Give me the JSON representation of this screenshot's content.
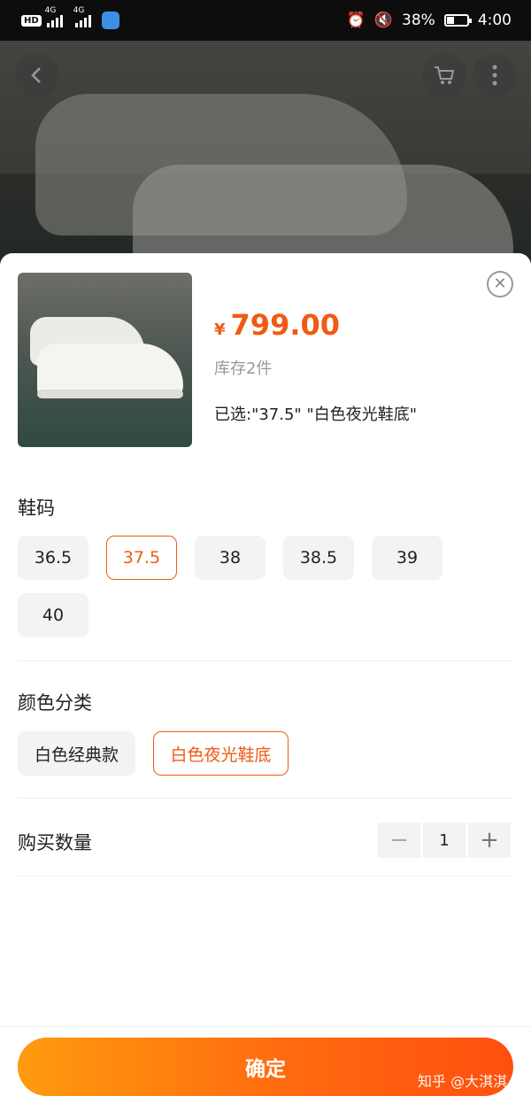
{
  "status_bar": {
    "hd": "HD",
    "net1": "4G",
    "net2": "4G",
    "battery": "38%",
    "battery_level": 0.38,
    "time": "4:00"
  },
  "product": {
    "currency": "¥",
    "price": "799.00",
    "stock": "库存2件",
    "selected": "已选:\"37.5\" \"白色夜光鞋底\""
  },
  "size": {
    "title": "鞋码",
    "options": [
      "36.5",
      "37.5",
      "38",
      "38.5",
      "39",
      "40"
    ],
    "selected": "37.5"
  },
  "color": {
    "title": "颜色分类",
    "options": [
      "白色经典款",
      "白色夜光鞋底"
    ],
    "selected": "白色夜光鞋底"
  },
  "quantity": {
    "label": "购买数量",
    "value": "1",
    "minus": "−",
    "plus": "+"
  },
  "confirm_label": "确定",
  "watermark": "知乎 @大淇淇",
  "colors": {
    "accent": "#f05a12",
    "button_gradient_start": "#ff9b0e",
    "button_gradient_end": "#ff4f0f"
  }
}
